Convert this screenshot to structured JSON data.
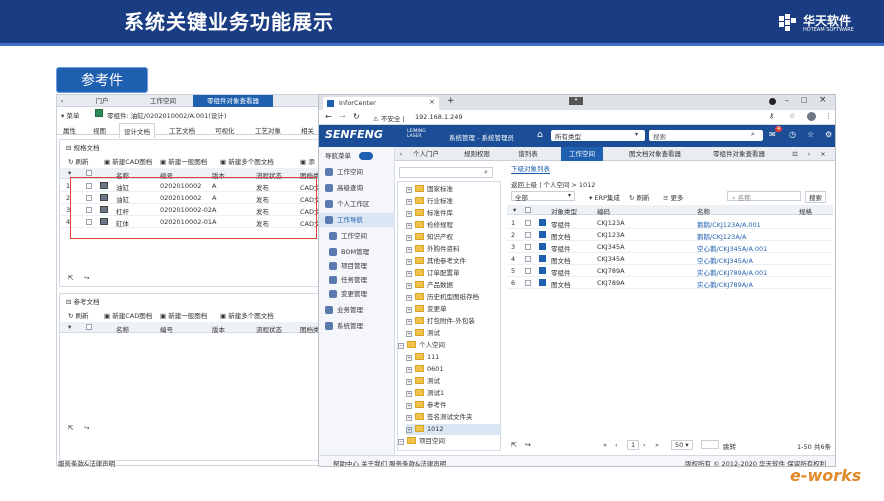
{
  "slide": {
    "title": "系统关键业务功能展示",
    "ref_label": "参考件",
    "logo_text": "华天软件",
    "logo_sub": "HOTEAM SOFTWARE",
    "ework": "e-works",
    "footer_left": "服务条款&法律声明"
  },
  "left": {
    "tabs": [
      "门户",
      "工作空间",
      "零组件对象查看器"
    ],
    "menu": "菜单",
    "obj_title": "零组件: 油缸/0202010002/A.001(设计)",
    "subtabs": [
      "属性",
      "视图",
      "设计文档",
      "工艺文档",
      "可视化",
      "工艺对象",
      "相关"
    ],
    "sec1": "规格文档",
    "sec2": "参考文档",
    "toolbar": [
      "刷新",
      "新建CAD图档",
      "新建一般图档",
      "新建多个图文档",
      "添"
    ],
    "headers": [
      "名称",
      "编号",
      "版本",
      "流程状态",
      "图档类"
    ],
    "rows": [
      {
        "n": "1",
        "name": "油缸",
        "code": "0202010002",
        "ver": "A",
        "state": "发布",
        "type": "CAD文"
      },
      {
        "n": "2",
        "name": "油缸",
        "code": "0202010002",
        "ver": "A",
        "state": "发布",
        "type": "CAD文"
      },
      {
        "n": "3",
        "name": "杠杆",
        "code": "0202010002-02",
        "ver": "A",
        "state": "发布",
        "type": "CAD文"
      },
      {
        "n": "4",
        "name": "缸体",
        "code": "0202010002-01",
        "ver": "A",
        "state": "发布",
        "type": "CAD文"
      }
    ]
  },
  "right": {
    "tab_title": "InforCenter",
    "insecure": "不安全",
    "url": "192.168.1.249",
    "brand": "SENFENG",
    "brand_sub": "LEIMING LASER",
    "admin": "系统管理 - 系统管理员",
    "type_select": "所有类型",
    "search_ph": "搜索",
    "sidebar_toggle": "导航菜单",
    "sidebar": [
      "工作空间",
      "高级查询",
      "个人工作区",
      "工作导航",
      "工作空间",
      "BOM管理",
      "项目管理",
      "任务管理",
      "变更管理",
      "业务管理",
      "系统管理"
    ],
    "navtabs": [
      "个人门户",
      "规则权限",
      "谱列表",
      "工作空间",
      "图文档对象查看器",
      "零组件对象查看器"
    ],
    "tree": [
      "国家标准",
      "行业标准",
      "标准件库",
      "检修规程",
      "知识产权",
      "外购件资料",
      "其他参考文件",
      "订单配置单",
      "产品数据",
      "历史机型图纸存档",
      "变更单",
      "打包附件-外包装",
      "测试",
      "个人空间",
      "111",
      "0601",
      "测试",
      "测试1",
      "参考件",
      "签名测试文件夹",
      "1012",
      "项目空间"
    ],
    "content_tab": "下级对象列表",
    "crumbs": "返回上级 | 个人空间 > 1012",
    "filter": [
      "全部",
      "ERP集成",
      "刷新",
      "更多",
      "名称",
      "搜索"
    ],
    "headers": [
      "对象类型",
      "编码",
      "名称",
      "规格"
    ],
    "rows": [
      {
        "n": "1",
        "type": "零组件",
        "code": "CKJ123A",
        "name": "鹅鹅/CKJ123A/A.001"
      },
      {
        "n": "2",
        "type": "图文档",
        "code": "CKJ123A",
        "name": "鹅鹅/CKJ123A/A"
      },
      {
        "n": "3",
        "type": "零组件",
        "code": "CKJ345A",
        "name": "空心鹅/CKJ345A/A.001"
      },
      {
        "n": "4",
        "type": "图文档",
        "code": "CKJ345A",
        "name": "空心鹅/CKJ345A/A"
      },
      {
        "n": "5",
        "type": "零组件",
        "code": "CKJ789A",
        "name": "实心鹅/CKJ789A/A.001"
      },
      {
        "n": "6",
        "type": "图文档",
        "code": "CKJ789A",
        "name": "实心鹅/CKJ789A/A"
      }
    ],
    "pager": {
      "page": "1",
      "size": "50",
      "jump": "跳转",
      "summary": "1-50 共6条"
    },
    "status_left": "帮助中心 关于我们 服务条款&法律声明",
    "status_right": "版权所有 © 2012-2020 华天软件 保留所有权利",
    "badge": "4"
  }
}
